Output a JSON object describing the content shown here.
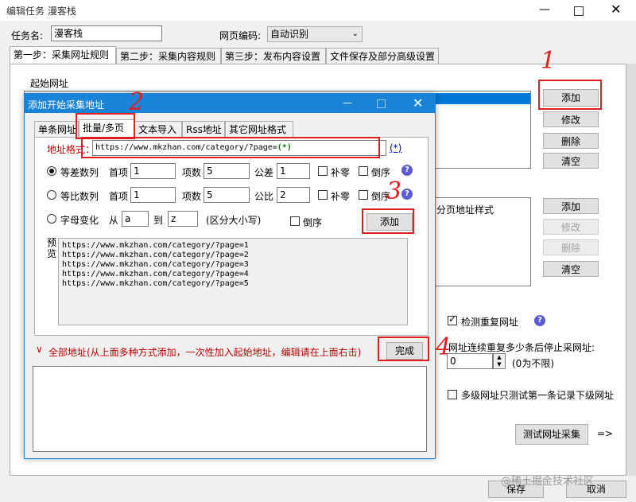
{
  "window": {
    "title": "编辑任务 漫客栈",
    "task_name_label": "任务名:",
    "task_name_value": "漫客栈",
    "encoding_label": "网页编码:",
    "encoding_value": "自动识别",
    "tabs": [
      "第一步：采集网址规则",
      "第二步：采集内容规则",
      "第三步：发布内容设置",
      "文件保存及部分高级设置"
    ],
    "start_url_section": "起始网址",
    "buttons_top": [
      "添加",
      "修改",
      "删除",
      "清空"
    ],
    "page_url_style": "分页地址样式",
    "buttons_mid": [
      "添加",
      "修改",
      "删除",
      "清空"
    ],
    "check_dup_label": "检测重复网址",
    "stop_label": "网址连续重复多少条后停止采网址:",
    "stop_value": "0",
    "stop_hint": "(0为不限)",
    "multi_level_label": "多级网址只测试第一条记录下级网址",
    "test_button": "测试网址采集",
    "arrow_text": "=>",
    "save_button": "保存",
    "cancel_button": "取消",
    "watermark": "@稀土掘金技术社区"
  },
  "dialog": {
    "title": "添加开始采集地址",
    "tabs": [
      "单条网址",
      "批量/多页",
      "文本导入",
      "Rss地址",
      "其它网址格式"
    ],
    "addr_format_label": "地址格式：",
    "addr_format_value": "https://www.mkzhan.com/category/?page=",
    "addr_wildcard": "(*)",
    "addr_link": "(*)",
    "row1": {
      "label": "等差数列",
      "first_label": "首项",
      "first": "1",
      "count_label": "项数",
      "count": "5",
      "step_label": "公差",
      "step": "1",
      "pad_label": "补零",
      "rev_label": "倒序"
    },
    "row2": {
      "label": "等比数列",
      "first_label": "首项",
      "first": "1",
      "count_label": "项数",
      "count": "5",
      "step_label": "公比",
      "step": "2",
      "pad_label": "补零",
      "rev_label": "倒序"
    },
    "row3": {
      "label": "字母变化",
      "from_label": "从",
      "from": "a",
      "to_label": "到",
      "to": "z",
      "case_hint": "(区分大小写)",
      "rev_label": "倒序"
    },
    "add_button": "添加",
    "preview_label": "预览",
    "preview": [
      "https://www.mkzhan.com/category/?page=1",
      "https://www.mkzhan.com/category/?page=2",
      "https://www.mkzhan.com/category/?page=3",
      "https://www.mkzhan.com/category/?page=4",
      "https://www.mkzhan.com/category/?page=5"
    ],
    "all_addr_label": "全部地址(从上面多种方式添加，一次性加入起始地址，编辑请在上面右击)",
    "done_button": "完成"
  },
  "annotations": [
    "1",
    "2",
    "3",
    "4"
  ],
  "colors": {
    "accent": "#1883d7",
    "annotation": "#e02020",
    "wildcard": "#008000",
    "link": "#0000ee"
  }
}
